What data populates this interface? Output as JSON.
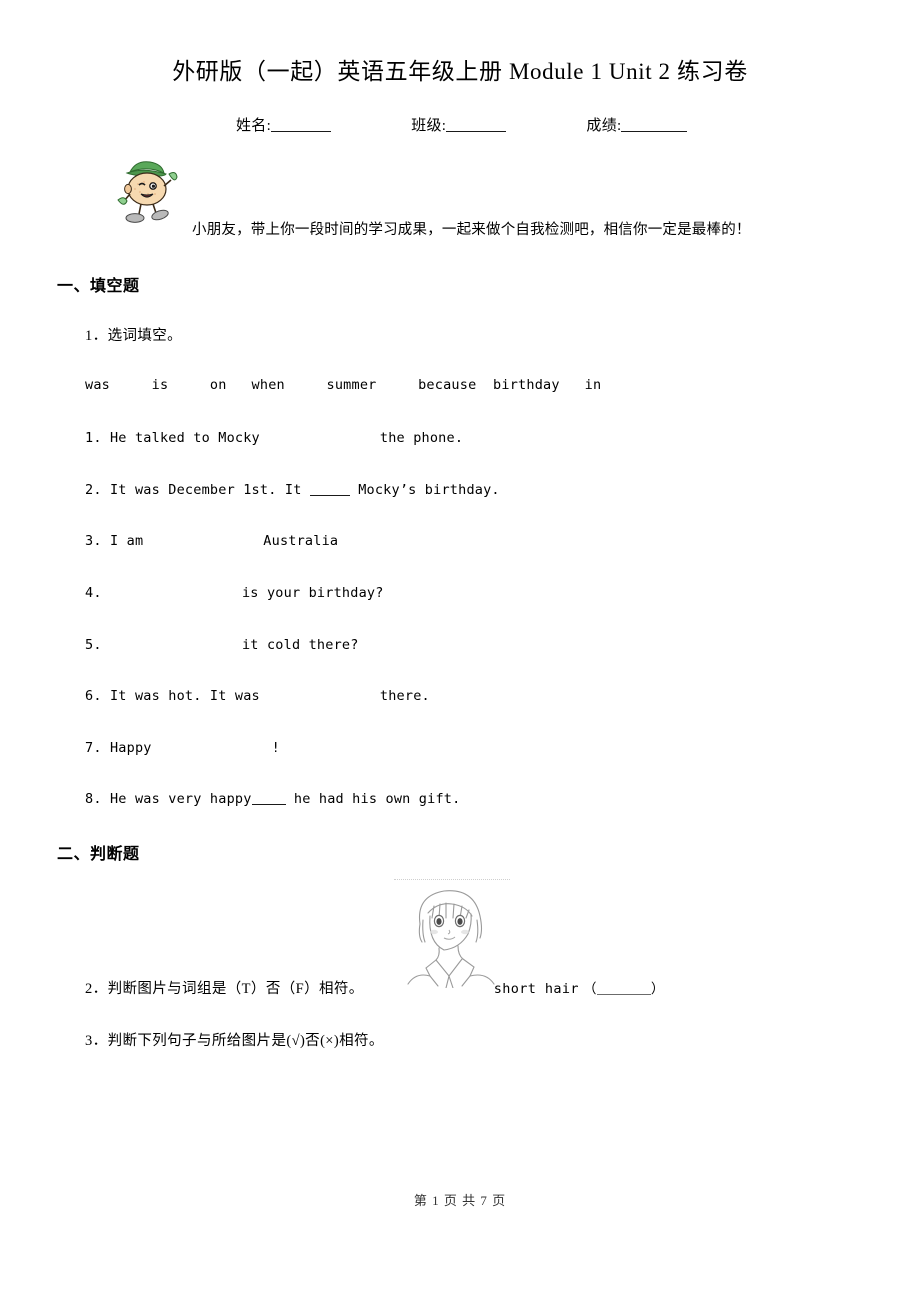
{
  "document": {
    "title": "外研版（一起）英语五年级上册 Module 1 Unit 2 练习卷"
  },
  "info_row": {
    "name_label": "姓名:",
    "class_label": "班级:",
    "score_label": "成绩:"
  },
  "mascot": {
    "icon": "cartoon-student-mascot",
    "greeting": "小朋友，带上你一段时间的学习成果，一起来做个自我检测吧，相信你一定是最棒的！"
  },
  "sections": [
    {
      "heading": "一、填空题",
      "items": [
        {
          "number": "1．",
          "prompt": "选词填空。",
          "word_bank": "was     is     on   when     summer     because  birthday   in",
          "questions": [
            {
              "num": "1.",
              "before": "He talked to Mocky",
              "gap": "blank",
              "after": "the phone."
            },
            {
              "num": "2.",
              "before": "It was December 1st. It",
              "gap": "underline",
              "after": "Mocky’s birthday."
            },
            {
              "num": "3.",
              "before": "I am",
              "gap": "blank",
              "after": "Australia"
            },
            {
              "num": "4.",
              "before": "",
              "gap": "blank",
              "after": "is your birthday?"
            },
            {
              "num": "5.",
              "before": "",
              "gap": "blank",
              "after": "it cold there?"
            },
            {
              "num": "6.",
              "before": "It was hot. It was",
              "gap": "blank",
              "after": "there."
            },
            {
              "num": "7.",
              "before": "Happy",
              "gap": "blank",
              "after": "!"
            },
            {
              "num": "8.",
              "before": "He was very happy",
              "gap": "underline",
              "after": "he had his own gift."
            }
          ]
        }
      ]
    },
    {
      "heading": "二、判断题",
      "items": [
        {
          "number": "2．",
          "prompt": "判断图片与词组是（T）否（F）相符。",
          "picture": "girl-short-hair-sketch",
          "phrase": "short hair",
          "answer_open": "（",
          "answer_close": "）"
        },
        {
          "number": "3．",
          "prompt": "判断下列句子与所给图片是(√)否(×)相符。"
        }
      ]
    }
  ],
  "footer": {
    "text": "第 1 页 共 7 页"
  }
}
